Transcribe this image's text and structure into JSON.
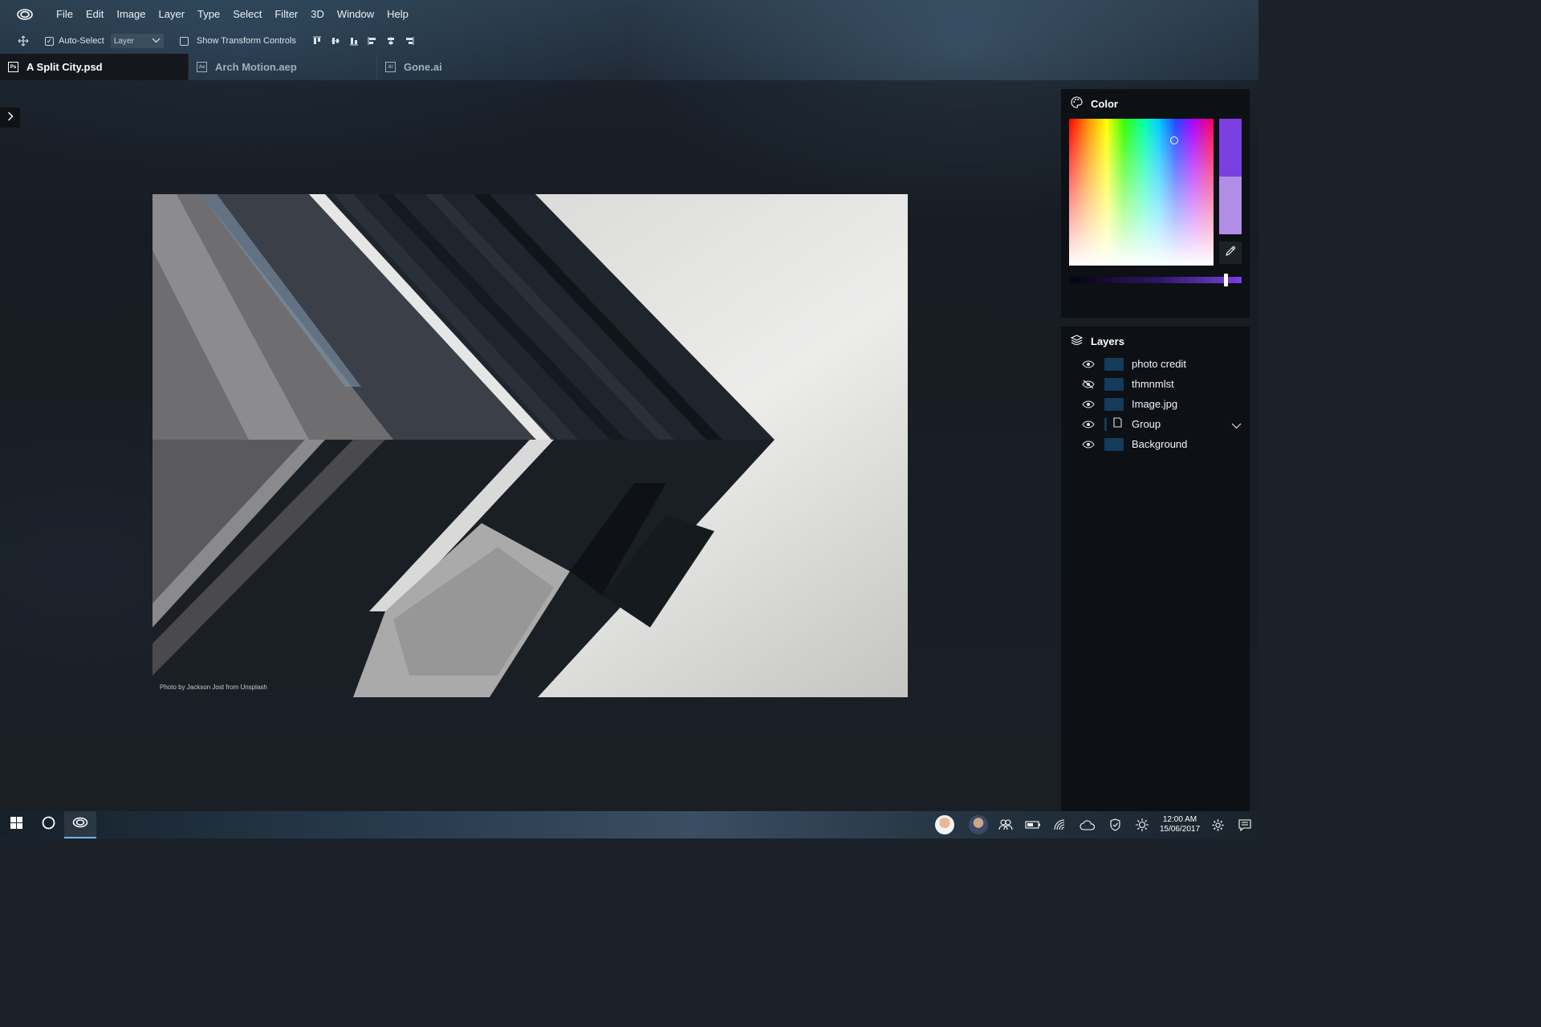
{
  "menubar": {
    "items": [
      "File",
      "Edit",
      "Image",
      "Layer",
      "Type",
      "Select",
      "Filter",
      "3D",
      "Window",
      "Help"
    ]
  },
  "options": {
    "auto_select_label": "Auto-Select",
    "auto_select_checked": true,
    "auto_select_mode": "Layer",
    "show_transform_label": "Show Transform Controls",
    "show_transform_checked": false
  },
  "tabs": [
    {
      "icon_text": "Ps",
      "label": "A Split City.psd",
      "active": true
    },
    {
      "icon_text": "Ae",
      "label": "Arch Motion.aep",
      "active": false
    },
    {
      "icon_text": "Ai",
      "label": "Gone.ai",
      "active": false
    }
  ],
  "canvas": {
    "credit": "Photo by Jackson Jost from Unsplash"
  },
  "color_panel": {
    "title": "Color",
    "current_color": "#7a3fe0",
    "previous_color": "#b08ee6"
  },
  "layers_panel": {
    "title": "Layers",
    "layers": [
      {
        "name": "photo credit",
        "visible": true,
        "type": "layer"
      },
      {
        "name": "thmnmlst",
        "visible": false,
        "type": "layer"
      },
      {
        "name": "Image.jpg",
        "visible": true,
        "type": "layer"
      },
      {
        "name": "Group",
        "visible": true,
        "type": "group"
      },
      {
        "name": "Background",
        "visible": true,
        "type": "layer"
      }
    ]
  },
  "taskbar": {
    "time": "12:00 AM",
    "date": "15/06/2017"
  },
  "colors": {
    "accent": "#7a3fe0",
    "layer_thumb": "#143a5c"
  }
}
